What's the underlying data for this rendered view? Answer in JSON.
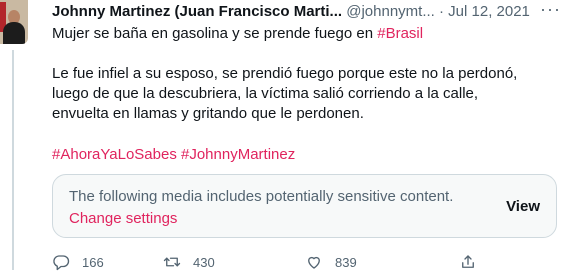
{
  "tweet": {
    "author_name": "Johnny Martinez (Juan Francisco Marti...",
    "handle": "@johnnymt...",
    "separator": "·",
    "date": "Jul 12, 2021",
    "more_label": "···",
    "line1_text": "Mujer se baña en gasolina y se prende fuego en ",
    "line1_hashtag": "#Brasil",
    "paragraph2": "Le fue infiel a su esposo, se prendió fuego porque este no la perdonó, luego de que la descubriera, la víctima salió corriendo a la calle, envuelta en llamas y gritando que le perdonen.",
    "hashtag1": "#AhoraYaLoSabes",
    "hashtag2": "#JohnnyMartinez"
  },
  "sensitive_media": {
    "notice": "The following media includes potentially sensitive content.",
    "change_settings": "Change settings",
    "view_label": "View"
  },
  "actions": {
    "replies": "166",
    "retweets": "430",
    "likes": "839"
  },
  "icons": {
    "reply": "reply-icon",
    "retweet": "retweet-icon",
    "like": "heart-icon",
    "share": "share-icon"
  },
  "colors": {
    "accent": "#e0245e",
    "secondary_text": "#536471"
  }
}
